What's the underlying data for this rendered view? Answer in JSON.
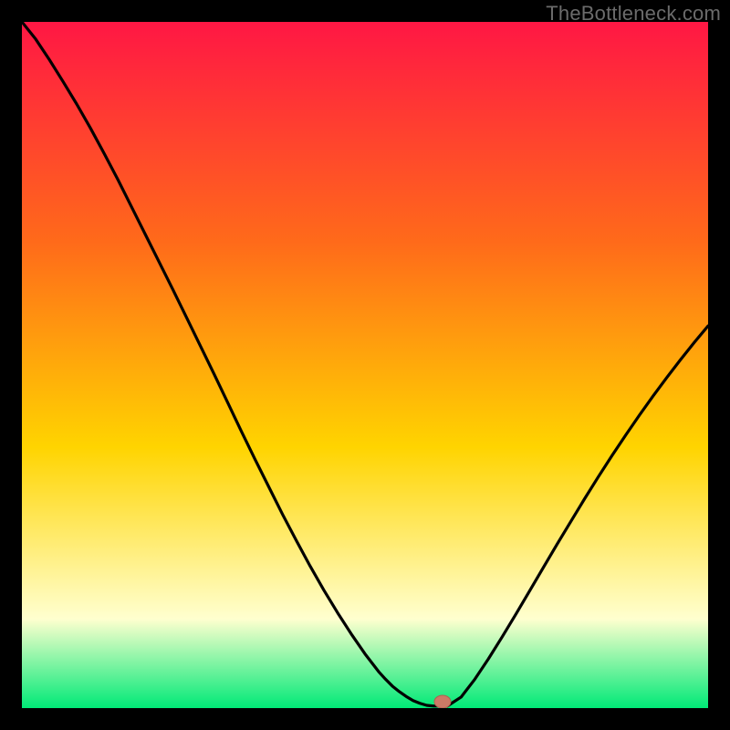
{
  "attribution": "TheBottleneck.com",
  "colors": {
    "frame": "#000000",
    "gradient_top": "#ff1744",
    "gradient_mid_upper": "#ff6a1a",
    "gradient_mid": "#ffd400",
    "gradient_pale": "#ffffcf",
    "gradient_green": "#00e977",
    "curve": "#000000",
    "marker_fill": "#cc7a66",
    "marker_stroke": "#b06050"
  },
  "chart_data": {
    "type": "line",
    "title": "",
    "xlabel": "",
    "ylabel": "",
    "xlim": [
      0,
      100
    ],
    "ylim": [
      0,
      100
    ],
    "x": [
      0,
      2,
      4,
      6,
      8,
      10,
      12,
      14,
      16,
      18,
      20,
      22,
      24,
      26,
      28,
      30,
      32,
      34,
      36,
      38,
      40,
      42,
      44,
      46,
      48,
      50,
      51,
      52,
      53,
      54,
      55,
      56,
      57,
      58,
      59,
      60,
      62,
      64,
      66,
      68,
      70,
      72,
      74,
      76,
      78,
      80,
      82,
      84,
      86,
      88,
      90,
      92,
      94,
      96,
      98,
      100
    ],
    "values": [
      100,
      97.5,
      94.5,
      91.3,
      88.0,
      84.5,
      80.8,
      77.0,
      73.0,
      69.0,
      65.0,
      61.0,
      56.9,
      52.8,
      48.7,
      44.5,
      40.3,
      36.2,
      32.2,
      28.2,
      24.4,
      20.7,
      17.2,
      13.9,
      10.8,
      7.9,
      6.6,
      5.3,
      4.2,
      3.2,
      2.4,
      1.7,
      1.1,
      0.7,
      0.4,
      0.3,
      0.3,
      1.6,
      4.2,
      7.2,
      10.4,
      13.7,
      17.1,
      20.5,
      23.9,
      27.2,
      30.5,
      33.7,
      36.8,
      39.8,
      42.7,
      45.5,
      48.2,
      50.8,
      53.3,
      55.7
    ],
    "marker": {
      "x": 61.3,
      "y": 0
    },
    "flat_bottom": {
      "x0": 58,
      "x1": 62,
      "y": 0.3
    }
  }
}
